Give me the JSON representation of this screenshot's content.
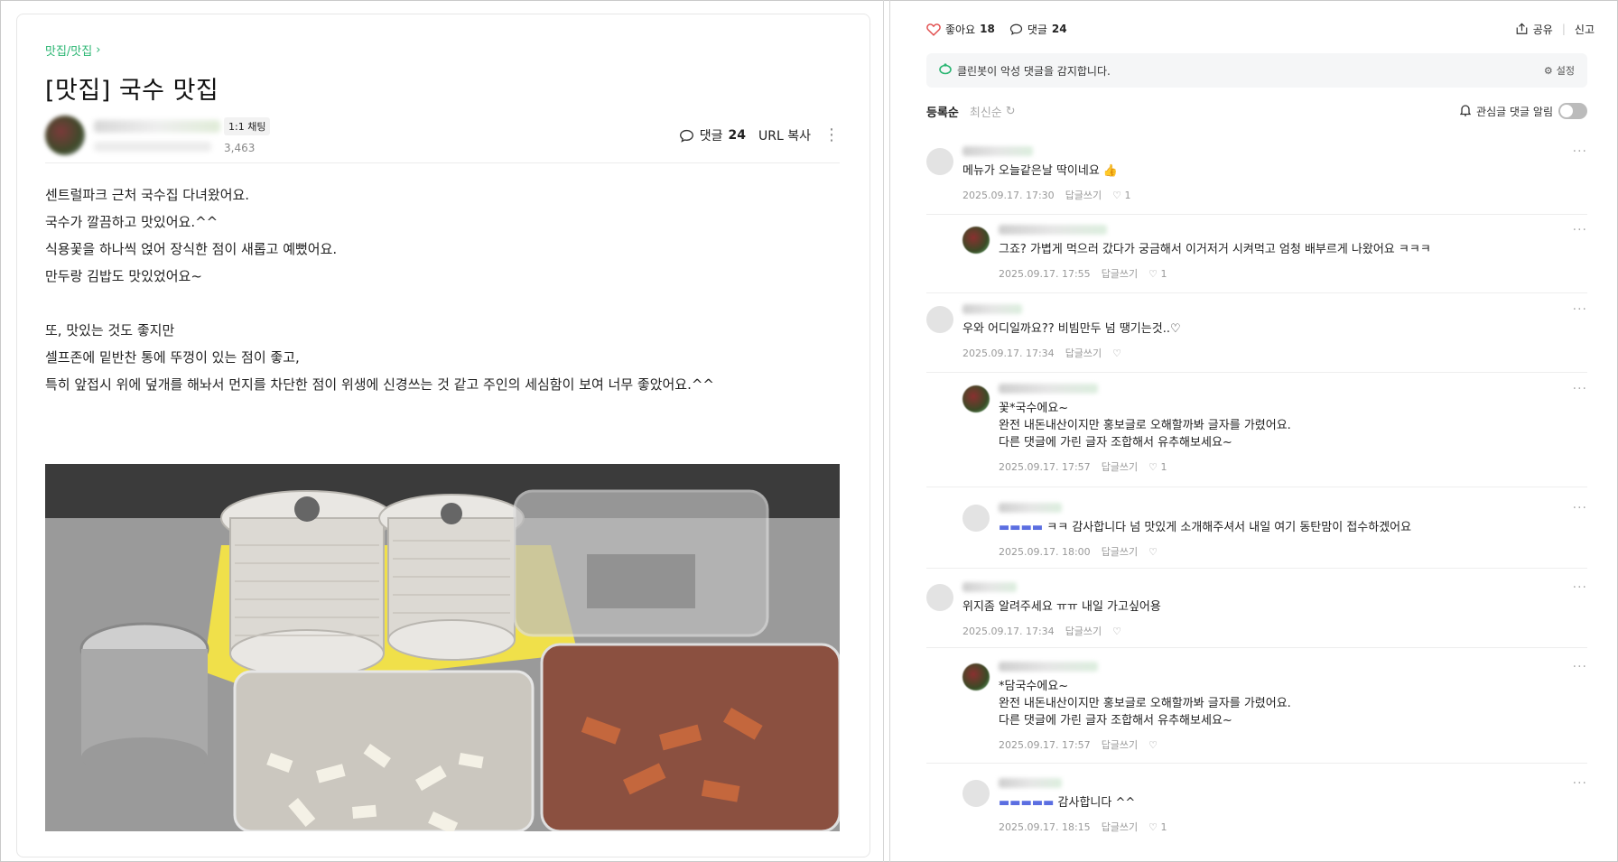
{
  "post": {
    "breadcrumb": "맛집/맛집",
    "breadcrumb_chevron": "›",
    "title": "[맛집] 국수 맛집",
    "chat_badge": "1:1 채팅",
    "views": "3,463",
    "comment_label": "댓글",
    "comment_count": "24",
    "url_copy": "URL 복사",
    "more": "⋮",
    "lines": [
      "센트럴파크 근처 국수집 다녀왔어요.",
      "국수가 깔끔하고 맛있어요.^^",
      "식용꽃을 하나씩 얹어 장식한 점이 새롭고 예뻤어요.",
      "만두랑 김밥도 맛있었어요~",
      "",
      "또, 맛있는 것도 좋지만",
      "셀프존에 밑반찬 통에 뚜껑이 있는 점이 좋고,",
      "특히 앞접시 위에 덮개를 해놔서 먼지를 차단한 점이 위생에 신경쓰는 것 같고 주인의 세심함이 보여 너무 좋았어요.^^"
    ]
  },
  "comments_panel": {
    "like_label": "좋아요",
    "like_count": "18",
    "comment_label": "댓글",
    "comment_count": "24",
    "share": "공유",
    "report": "신고",
    "cleanbot_text": "클린봇이 악성 댓글을 감지합니다.",
    "cleanbot_setting": "설정",
    "sort_active": "등록순",
    "sort_inactive": "최신순",
    "alarm_label": "관심글 댓글 알림",
    "reply_label": "답글쓰기",
    "comments": [
      {
        "reply": false,
        "text": [
          "메뉴가 오늘같은날 딱이네요 👍"
        ],
        "date": "2025.09.17. 17:30",
        "likes": "1"
      },
      {
        "reply": true,
        "text": [
          "그죠? 가볍게 먹으러 갔다가 궁금해서 이거저거 시켜먹고 엄청 배부르게 나왔어요 ㅋㅋㅋ"
        ],
        "date": "2025.09.17. 17:55",
        "likes": "1"
      },
      {
        "reply": false,
        "text": [
          "우와 어디일까요?? 비빔만두 넘 땡기는것..♡"
        ],
        "date": "2025.09.17. 17:34",
        "likes": ""
      },
      {
        "reply": true,
        "text": [
          "꽃*국수에요~",
          "완전 내돈내산이지만 홍보글로 오해할까봐 글자를 가렸어요.",
          "다른 댓글에 가린 글자 조합해서 유추해보세요~"
        ],
        "date": "2025.09.17. 17:57",
        "likes": "1"
      },
      {
        "reply": true,
        "text": [
          "ㅋㅋ 감사합니다 넘 맛있게 소개해주셔서 내일 여기 동탄맘이 접수하겠어요"
        ],
        "date": "2025.09.17. 18:00",
        "likes": ""
      },
      {
        "reply": false,
        "text": [
          "위지좀 알려주세요 ㅠㅠ 내일 가고싶어용"
        ],
        "date": "2025.09.17. 17:34",
        "likes": ""
      },
      {
        "reply": true,
        "text": [
          "*담국수에요~",
          "완전 내돈내산이지만 홍보글로 오해할까봐 글자를 가렸어요.",
          "다른 댓글에 가린 글자 조합해서 유추해보세요~"
        ],
        "date": "2025.09.17. 17:57",
        "likes": ""
      },
      {
        "reply": true,
        "text": [
          "감사합니다 ^^"
        ],
        "date": "2025.09.17. 18:15",
        "likes": "1"
      }
    ]
  },
  "colors": {
    "accent": "#2bb673",
    "heart": "#e14b4b"
  },
  "icons": [
    "chevron-right-icon",
    "speech-bubble-icon",
    "kebab-icon",
    "heart-icon",
    "share-icon",
    "cleanbot-icon",
    "gear-icon",
    "refresh-icon",
    "bell-icon",
    "toggle-switch"
  ]
}
